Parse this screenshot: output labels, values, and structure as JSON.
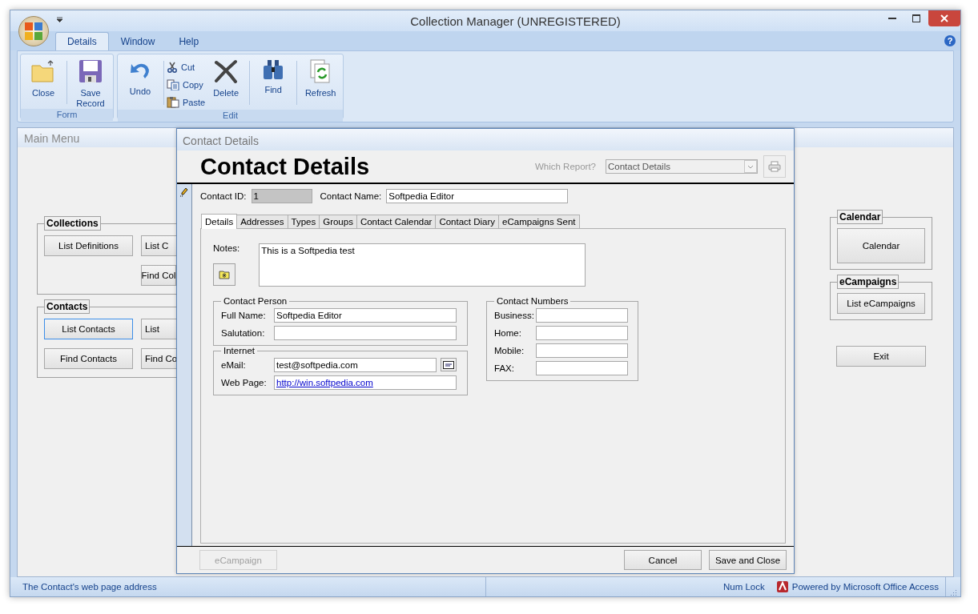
{
  "window": {
    "title": "Collection Manager (UNREGISTERED)",
    "help": "?"
  },
  "ribbon_tabs": [
    {
      "label": "Details",
      "selected": true
    },
    {
      "label": "Window",
      "selected": false
    },
    {
      "label": "Help",
      "selected": false
    }
  ],
  "ribbon_groups": [
    {
      "label": "Form",
      "items": [
        {
          "label": "Close",
          "kind": "large",
          "divider": false
        },
        {
          "label": "Save Record",
          "kind": "large",
          "divider": true
        }
      ]
    },
    {
      "label": "Edit",
      "items": [
        {
          "label": "Undo",
          "kind": "large",
          "divider": false
        },
        {
          "label": "Cut",
          "kind": "small",
          "divider": true
        },
        {
          "label": "Copy",
          "kind": "small",
          "divider": false
        },
        {
          "label": "Paste",
          "kind": "small",
          "divider": false
        },
        {
          "label": "Delete",
          "kind": "large",
          "divider": false
        },
        {
          "label": "Find",
          "kind": "large",
          "divider": true
        },
        {
          "label": "Refresh",
          "kind": "large",
          "divider": true
        }
      ]
    }
  ],
  "main_menu": {
    "title": "Main Menu",
    "left_groups": [
      {
        "title": "Collections",
        "buttons": [
          {
            "label": "List Definitions",
            "focused": false
          },
          {
            "label": "List C",
            "focused": false
          },
          {
            "label": "Find Col",
            "focused": false
          }
        ]
      },
      {
        "title": "Contacts",
        "buttons": [
          {
            "label": "List Contacts",
            "focused": true
          },
          {
            "label": "List",
            "focused": false
          },
          {
            "label": "Find Contacts",
            "focused": false
          },
          {
            "label": "Find Co",
            "focused": false
          }
        ]
      }
    ],
    "right_groups": [
      {
        "title": "Calendar",
        "button": "Calendar"
      },
      {
        "title": "eCampaigns",
        "button": "List eCampaigns"
      }
    ],
    "exit": "Exit"
  },
  "contact_form": {
    "title": "Contact Details",
    "heading": "Contact Details",
    "report_label": "Which Report?",
    "report_value": "Contact Details",
    "contact_id": {
      "label": "Contact ID:",
      "value": "1",
      "locked": true
    },
    "contact_name": {
      "label": "Contact Name:",
      "value": "Softpedia Editor",
      "locked": false
    },
    "tabs": [
      {
        "label": "Details",
        "selected": true
      },
      {
        "label": "Addresses",
        "selected": false
      },
      {
        "label": "Types",
        "selected": false
      },
      {
        "label": "Groups",
        "selected": false
      },
      {
        "label": "Contact Calendar",
        "selected": false
      },
      {
        "label": "Contact Diary",
        "selected": false
      },
      {
        "label": "eCampaigns Sent",
        "selected": false
      }
    ],
    "notes": {
      "label": "Notes:",
      "value": "This is a Softpedia test"
    },
    "contact_person": {
      "title": "Contact Person",
      "fields": [
        {
          "label": "Full Name:",
          "value": "Softpedia Editor"
        },
        {
          "label": "Salutation:"
        }
      ]
    },
    "internet": {
      "title": "Internet",
      "fields": [
        {
          "label": "eMail:",
          "value": "test@softpedia.com",
          "kind": "email"
        },
        {
          "label": "Web Page:",
          "value": "http://win.softpedia.com",
          "kind": "link"
        }
      ]
    },
    "contact_numbers": {
      "title": "Contact Numbers",
      "fields": [
        {
          "label": "Business:"
        },
        {
          "label": "Home:"
        },
        {
          "label": "Mobile:"
        },
        {
          "label": "FAX:"
        }
      ]
    },
    "buttons": [
      {
        "label": "eCampaign",
        "disabled": true
      },
      {
        "label": "Cancel",
        "disabled": false
      },
      {
        "label": "Save and Close",
        "disabled": false
      }
    ]
  },
  "status_bar": {
    "message": "The Contact's web page address",
    "num_lock": "Num Lock",
    "powered_by": "Powered by Microsoft Office Access"
  }
}
